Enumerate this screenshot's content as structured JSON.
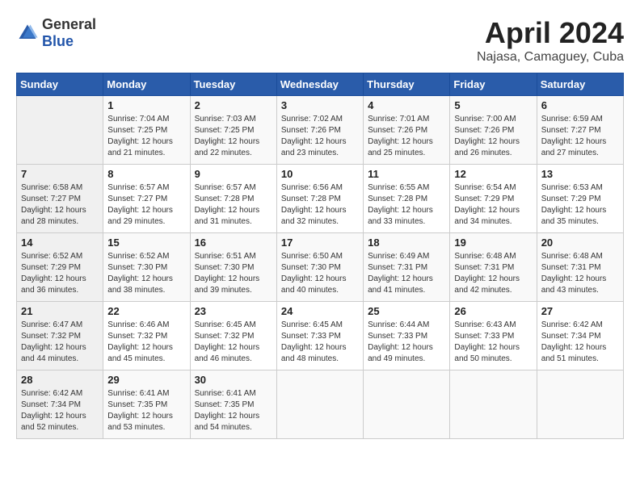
{
  "header": {
    "logo_general": "General",
    "logo_blue": "Blue",
    "title": "April 2024",
    "location": "Najasa, Camaguey, Cuba"
  },
  "weekdays": [
    "Sunday",
    "Monday",
    "Tuesday",
    "Wednesday",
    "Thursday",
    "Friday",
    "Saturday"
  ],
  "weeks": [
    [
      {
        "day": "",
        "sunrise": "",
        "sunset": "",
        "daylight": ""
      },
      {
        "day": "1",
        "sunrise": "Sunrise: 7:04 AM",
        "sunset": "Sunset: 7:25 PM",
        "daylight": "Daylight: 12 hours and 21 minutes."
      },
      {
        "day": "2",
        "sunrise": "Sunrise: 7:03 AM",
        "sunset": "Sunset: 7:25 PM",
        "daylight": "Daylight: 12 hours and 22 minutes."
      },
      {
        "day": "3",
        "sunrise": "Sunrise: 7:02 AM",
        "sunset": "Sunset: 7:26 PM",
        "daylight": "Daylight: 12 hours and 23 minutes."
      },
      {
        "day": "4",
        "sunrise": "Sunrise: 7:01 AM",
        "sunset": "Sunset: 7:26 PM",
        "daylight": "Daylight: 12 hours and 25 minutes."
      },
      {
        "day": "5",
        "sunrise": "Sunrise: 7:00 AM",
        "sunset": "Sunset: 7:26 PM",
        "daylight": "Daylight: 12 hours and 26 minutes."
      },
      {
        "day": "6",
        "sunrise": "Sunrise: 6:59 AM",
        "sunset": "Sunset: 7:27 PM",
        "daylight": "Daylight: 12 hours and 27 minutes."
      }
    ],
    [
      {
        "day": "7",
        "sunrise": "Sunrise: 6:58 AM",
        "sunset": "Sunset: 7:27 PM",
        "daylight": "Daylight: 12 hours and 28 minutes."
      },
      {
        "day": "8",
        "sunrise": "Sunrise: 6:57 AM",
        "sunset": "Sunset: 7:27 PM",
        "daylight": "Daylight: 12 hours and 29 minutes."
      },
      {
        "day": "9",
        "sunrise": "Sunrise: 6:57 AM",
        "sunset": "Sunset: 7:28 PM",
        "daylight": "Daylight: 12 hours and 31 minutes."
      },
      {
        "day": "10",
        "sunrise": "Sunrise: 6:56 AM",
        "sunset": "Sunset: 7:28 PM",
        "daylight": "Daylight: 12 hours and 32 minutes."
      },
      {
        "day": "11",
        "sunrise": "Sunrise: 6:55 AM",
        "sunset": "Sunset: 7:28 PM",
        "daylight": "Daylight: 12 hours and 33 minutes."
      },
      {
        "day": "12",
        "sunrise": "Sunrise: 6:54 AM",
        "sunset": "Sunset: 7:29 PM",
        "daylight": "Daylight: 12 hours and 34 minutes."
      },
      {
        "day": "13",
        "sunrise": "Sunrise: 6:53 AM",
        "sunset": "Sunset: 7:29 PM",
        "daylight": "Daylight: 12 hours and 35 minutes."
      }
    ],
    [
      {
        "day": "14",
        "sunrise": "Sunrise: 6:52 AM",
        "sunset": "Sunset: 7:29 PM",
        "daylight": "Daylight: 12 hours and 36 minutes."
      },
      {
        "day": "15",
        "sunrise": "Sunrise: 6:52 AM",
        "sunset": "Sunset: 7:30 PM",
        "daylight": "Daylight: 12 hours and 38 minutes."
      },
      {
        "day": "16",
        "sunrise": "Sunrise: 6:51 AM",
        "sunset": "Sunset: 7:30 PM",
        "daylight": "Daylight: 12 hours and 39 minutes."
      },
      {
        "day": "17",
        "sunrise": "Sunrise: 6:50 AM",
        "sunset": "Sunset: 7:30 PM",
        "daylight": "Daylight: 12 hours and 40 minutes."
      },
      {
        "day": "18",
        "sunrise": "Sunrise: 6:49 AM",
        "sunset": "Sunset: 7:31 PM",
        "daylight": "Daylight: 12 hours and 41 minutes."
      },
      {
        "day": "19",
        "sunrise": "Sunrise: 6:48 AM",
        "sunset": "Sunset: 7:31 PM",
        "daylight": "Daylight: 12 hours and 42 minutes."
      },
      {
        "day": "20",
        "sunrise": "Sunrise: 6:48 AM",
        "sunset": "Sunset: 7:31 PM",
        "daylight": "Daylight: 12 hours and 43 minutes."
      }
    ],
    [
      {
        "day": "21",
        "sunrise": "Sunrise: 6:47 AM",
        "sunset": "Sunset: 7:32 PM",
        "daylight": "Daylight: 12 hours and 44 minutes."
      },
      {
        "day": "22",
        "sunrise": "Sunrise: 6:46 AM",
        "sunset": "Sunset: 7:32 PM",
        "daylight": "Daylight: 12 hours and 45 minutes."
      },
      {
        "day": "23",
        "sunrise": "Sunrise: 6:45 AM",
        "sunset": "Sunset: 7:32 PM",
        "daylight": "Daylight: 12 hours and 46 minutes."
      },
      {
        "day": "24",
        "sunrise": "Sunrise: 6:45 AM",
        "sunset": "Sunset: 7:33 PM",
        "daylight": "Daylight: 12 hours and 48 minutes."
      },
      {
        "day": "25",
        "sunrise": "Sunrise: 6:44 AM",
        "sunset": "Sunset: 7:33 PM",
        "daylight": "Daylight: 12 hours and 49 minutes."
      },
      {
        "day": "26",
        "sunrise": "Sunrise: 6:43 AM",
        "sunset": "Sunset: 7:33 PM",
        "daylight": "Daylight: 12 hours and 50 minutes."
      },
      {
        "day": "27",
        "sunrise": "Sunrise: 6:42 AM",
        "sunset": "Sunset: 7:34 PM",
        "daylight": "Daylight: 12 hours and 51 minutes."
      }
    ],
    [
      {
        "day": "28",
        "sunrise": "Sunrise: 6:42 AM",
        "sunset": "Sunset: 7:34 PM",
        "daylight": "Daylight: 12 hours and 52 minutes."
      },
      {
        "day": "29",
        "sunrise": "Sunrise: 6:41 AM",
        "sunset": "Sunset: 7:35 PM",
        "daylight": "Daylight: 12 hours and 53 minutes."
      },
      {
        "day": "30",
        "sunrise": "Sunrise: 6:41 AM",
        "sunset": "Sunset: 7:35 PM",
        "daylight": "Daylight: 12 hours and 54 minutes."
      },
      {
        "day": "",
        "sunrise": "",
        "sunset": "",
        "daylight": ""
      },
      {
        "day": "",
        "sunrise": "",
        "sunset": "",
        "daylight": ""
      },
      {
        "day": "",
        "sunrise": "",
        "sunset": "",
        "daylight": ""
      },
      {
        "day": "",
        "sunrise": "",
        "sunset": "",
        "daylight": ""
      }
    ]
  ]
}
